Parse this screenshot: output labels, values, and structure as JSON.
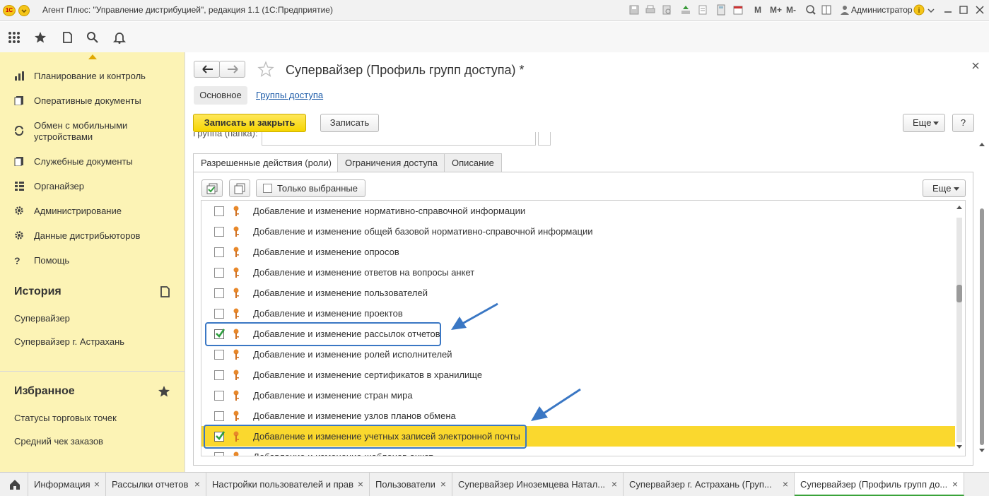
{
  "window": {
    "logo": "1С",
    "title": "Агент Плюс: \"Управление дистрибуцией\", редакция 1.1  (1С:Предприятие)",
    "m_buttons": [
      "M",
      "M+",
      "M-"
    ],
    "user": "Администратор"
  },
  "sidebar": {
    "nav": [
      {
        "label": "Планирование и контроль",
        "icon": "bar-chart-icon"
      },
      {
        "label": "Оперативные документы",
        "icon": "documents-icon"
      },
      {
        "label": "Обмен с мобильными устройствами",
        "icon": "sync-icon"
      },
      {
        "label": "Служебные документы",
        "icon": "documents-icon"
      },
      {
        "label": "Органайзер",
        "icon": "organizer-icon"
      },
      {
        "label": "Администрирование",
        "icon": "gear-icon"
      },
      {
        "label": "Данные дистрибьюторов",
        "icon": "gear-icon"
      },
      {
        "label": "Помощь",
        "icon": "question-icon"
      }
    ],
    "history": {
      "title": "История",
      "items": [
        "Супервайзер",
        "Супервайзер г. Астрахань"
      ]
    },
    "favorites": {
      "title": "Избранное",
      "items": [
        "Статусы торговых точек",
        "Средний чек заказов"
      ]
    }
  },
  "form": {
    "title": "Супервайзер (Профиль групп доступа) *",
    "nav_main": "Основное",
    "nav_link": "Группы доступа",
    "save_close": "Записать и закрыть",
    "save": "Записать",
    "more": "Еще",
    "help": "?",
    "group_label": "Группа (папка):",
    "tabs": [
      "Разрешенные действия (роли)",
      "Ограничения доступа",
      "Описание"
    ],
    "list_toolbar": {
      "only_selected": "Только выбранные",
      "more": "Еще"
    },
    "roles": [
      {
        "label": "Добавление и изменение нормативно-справочной информации",
        "checked": false,
        "selected": false
      },
      {
        "label": "Добавление и изменение общей базовой нормативно-справочной информации",
        "checked": false,
        "selected": false
      },
      {
        "label": "Добавление и изменение опросов",
        "checked": false,
        "selected": false
      },
      {
        "label": "Добавление и изменение ответов на вопросы анкет",
        "checked": false,
        "selected": false
      },
      {
        "label": "Добавление и изменение пользователей",
        "checked": false,
        "selected": false
      },
      {
        "label": "Добавление и изменение проектов",
        "checked": false,
        "selected": false
      },
      {
        "label": "Добавление и изменение рассылок отчетов",
        "checked": true,
        "selected": false
      },
      {
        "label": "Добавление и изменение ролей исполнителей",
        "checked": false,
        "selected": false
      },
      {
        "label": "Добавление и изменение сертификатов в хранилище",
        "checked": false,
        "selected": false
      },
      {
        "label": "Добавление и изменение стран мира",
        "checked": false,
        "selected": false
      },
      {
        "label": "Добавление и изменение узлов планов обмена",
        "checked": false,
        "selected": false
      },
      {
        "label": "Добавление и изменение учетных записей электронной почты",
        "checked": true,
        "selected": true
      },
      {
        "label": "Добавление и изменение шаблонов анкет",
        "checked": false,
        "selected": false
      }
    ]
  },
  "taskbar": {
    "tabs": [
      "Информация",
      "Рассылки отчетов",
      "Настройки пользователей и прав",
      "Пользователи",
      "Супервайзер Иноземцева Натал...",
      "Супервайзер г. Астрахань (Груп...",
      "Супервайзер (Профиль групп до..."
    ],
    "close": "×"
  },
  "colors": {
    "sidebar": "#fcf3b5",
    "accent_yellow": "#f6d500",
    "annotation_blue": "#3a77c4",
    "check_green": "#2e9e3e"
  }
}
